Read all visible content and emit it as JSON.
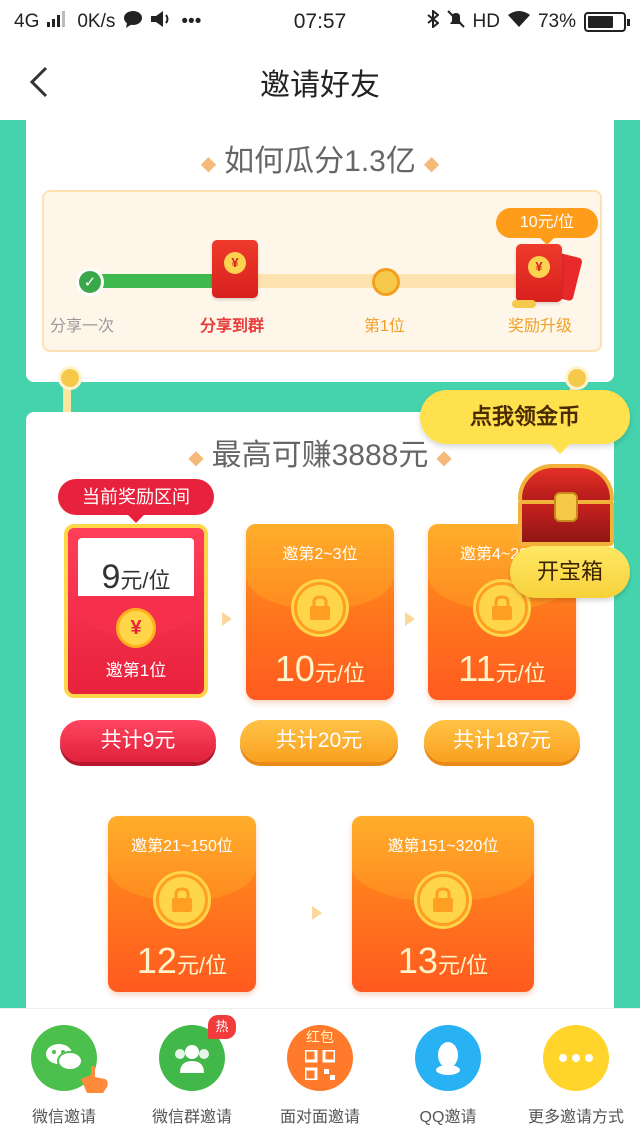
{
  "status_bar": {
    "network": "4G",
    "speed": "0K/s",
    "time": "07:57",
    "hd": "HD",
    "battery": "73%",
    "battery_level": 0.73
  },
  "nav": {
    "title": "邀请好友"
  },
  "how_section": {
    "title": "如何瓜分1.3亿",
    "bubble": "10元/位",
    "steps": [
      "分享一次",
      "分享到群",
      "第1位",
      "奖励升级"
    ]
  },
  "earn_section": {
    "title": "最高可赚3888元",
    "current_tag": "当前奖励区间",
    "current_tier": {
      "amount": "9",
      "unit": "元/位",
      "label": "邀第1位"
    },
    "tiers": [
      {
        "range": "邀第2~3位",
        "amount": "10",
        "unit": "元/位"
      },
      {
        "range": "邀第4~20位",
        "amount": "11",
        "unit": "元/位"
      },
      {
        "range": "邀第21~150位",
        "amount": "12",
        "unit": "元/位"
      },
      {
        "range": "邀第151~320位",
        "amount": "13",
        "unit": "元/位"
      }
    ],
    "totals": [
      "共计9元",
      "共计20元",
      "共计187元"
    ]
  },
  "float": {
    "coin_bubble": "点我领金币",
    "chest_label": "开宝箱"
  },
  "share_bar": {
    "hot_badge": "热",
    "items": [
      {
        "label": "微信邀请",
        "icon": "wechat-icon",
        "color": "#4cc04c"
      },
      {
        "label": "微信群邀请",
        "icon": "wechat-group-icon",
        "color": "#43b84a"
      },
      {
        "label": "面对面邀请",
        "icon": "qrcode-icon",
        "color": "#ff7a2a",
        "icon_text": "红包"
      },
      {
        "label": "QQ邀请",
        "icon": "qq-icon",
        "color": "#28b2f4"
      },
      {
        "label": "更多邀请方式",
        "icon": "more-icon",
        "color": "#ffd52b"
      }
    ]
  }
}
